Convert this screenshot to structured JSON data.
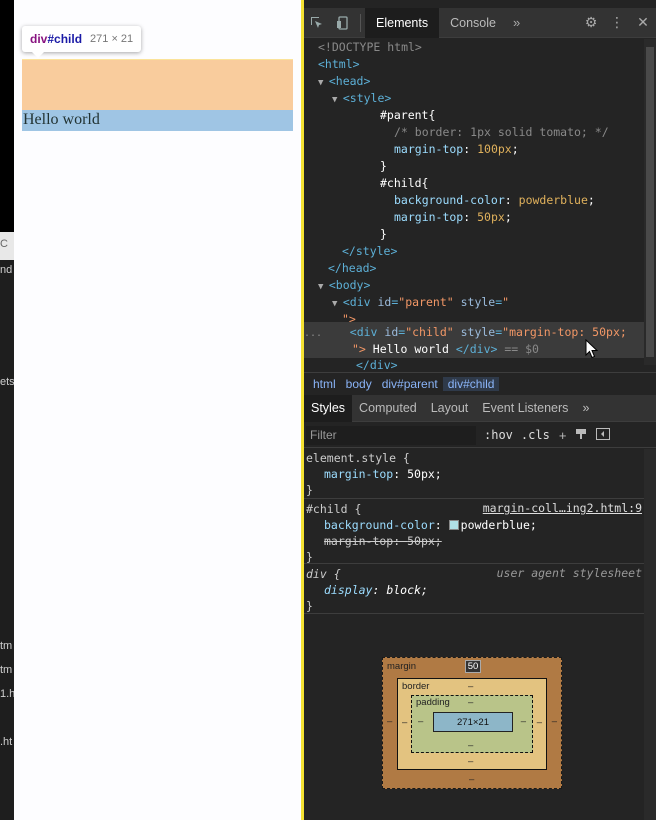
{
  "background_strip": {
    "fragments": [
      "C",
      "nd",
      "ets",
      "tm",
      "tm",
      "1.h",
      ".ht"
    ]
  },
  "page": {
    "tooltip": {
      "tag": "div",
      "id": "#child",
      "dims": "271 × 21"
    },
    "child_text": "Hello world"
  },
  "devtools": {
    "tabs": [
      "Elements",
      "Console"
    ],
    "active_tab": "Elements",
    "more": "»",
    "icons": [
      "inspect-icon",
      "device-toggle-icon",
      "gear-icon",
      "kebab-icon",
      "close-icon"
    ],
    "tree": {
      "doctype": "<!DOCTYPE html>",
      "html_open": "<html>",
      "head_open": "<head>",
      "style_open": "<style>",
      "parent_sel": "#parent{",
      "comment": "/* border: 1px solid tomato; */",
      "parent_prop": "margin-top",
      "parent_val": "100px",
      "close_brace": "}",
      "child_sel": "#child{",
      "child_prop1": "background-color",
      "child_val1": "powderblue",
      "child_prop2": "margin-top",
      "child_val2": "50px",
      "style_close": "</style>",
      "head_close": "</head>",
      "body_open": "<body>",
      "div_parent_tag": "<div",
      "div_parent_id_attr": "id",
      "div_parent_id_val": "\"parent\"",
      "div_parent_style_attr": "style",
      "div_parent_style_val": "\"",
      "div_parent_end": "\">",
      "dots": "...",
      "div_child_tag": "<div",
      "div_child_id_attr": "id",
      "div_child_id_val": "\"child\"",
      "div_child_style_attr": "style",
      "div_child_style_val": "\"margin-top: 50px;",
      "div_child_end": "\">",
      "div_child_text": " Hello world ",
      "div_child_close": "</div>",
      "eq_dollar": " == $0",
      "div_close": "</div>"
    },
    "breadcrumb": [
      "html",
      "body",
      "div#parent",
      "div#child"
    ],
    "subtabs": [
      "Styles",
      "Computed",
      "Layout",
      "Event Listeners"
    ],
    "active_subtab": "Styles",
    "filter": {
      "placeholder": "Filter",
      "hov": ":hov",
      "cls": ".cls",
      "plus": "+"
    },
    "rules": {
      "element_style": {
        "selector": "element.style {",
        "prop": "margin-top",
        "val": "50px;",
        "close": "}"
      },
      "child_rule": {
        "selector": "#child {",
        "source": "margin-coll…ing2.html:9",
        "prop1": "background-color",
        "val1": "powderblue;",
        "prop2": "margin-top",
        "val2": "50px;",
        "close": "}",
        "swatch_color": "#b0e0e6"
      },
      "ua_rule": {
        "selector": "div {",
        "source": "user agent stylesheet",
        "prop": "display",
        "val": "block;",
        "close": "}"
      }
    },
    "box_model": {
      "margin_label": "margin",
      "margin_top": "50",
      "border_label": "border",
      "padding_label": "padding",
      "content": "271×21",
      "dash": "–"
    }
  }
}
